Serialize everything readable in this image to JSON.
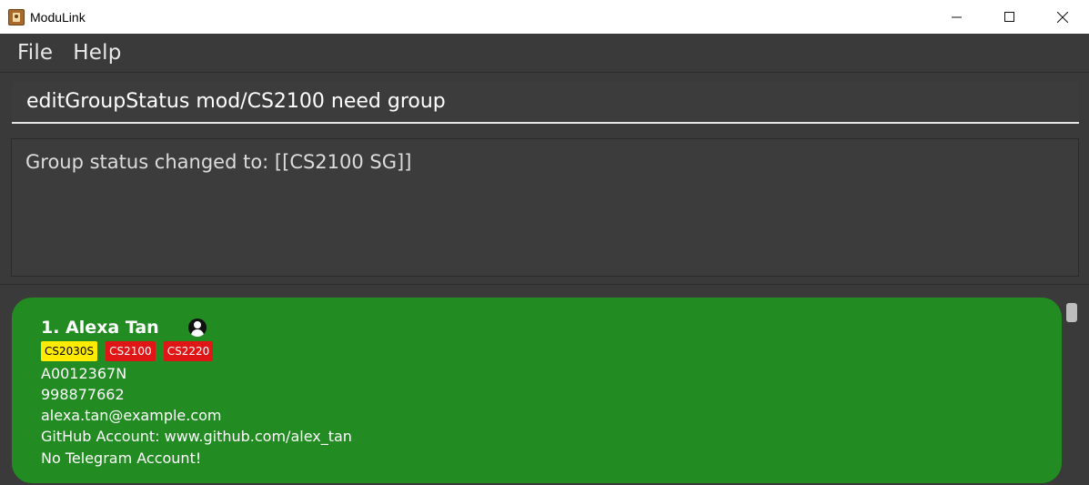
{
  "window": {
    "title": "ModuLink",
    "icon": "app-icon"
  },
  "menu": {
    "items": [
      {
        "label": "File"
      },
      {
        "label": "Help"
      }
    ]
  },
  "command": {
    "value": "editGroupStatus mod/CS2100 need group"
  },
  "result": {
    "text": "Group status changed to: [[CS2100 SG]]"
  },
  "persons": [
    {
      "name": "1. Alexa Tan",
      "tags": [
        {
          "label": "CS2030S",
          "color": "#ffeb00"
        },
        {
          "label": "CS2100",
          "color": "#e01515"
        },
        {
          "label": "CS2220",
          "color": "#e01515"
        }
      ],
      "student_id": "A0012367N",
      "phone": "998877662",
      "email": "alexa.tan@example.com",
      "github": "GitHub Account: www.github.com/alex_tan",
      "telegram": "No Telegram Account!"
    }
  ],
  "colors": {
    "card": "#228b22",
    "background": "#3a3a3a"
  }
}
